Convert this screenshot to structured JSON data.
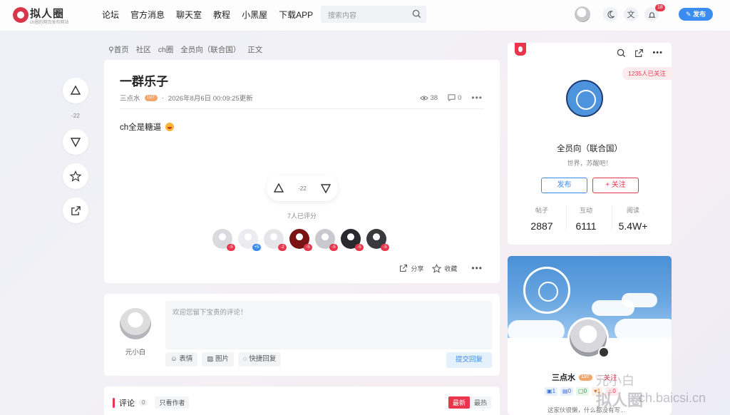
{
  "header": {
    "logo_text": "拟人圈",
    "logo_sub": "ch圈的网页发布网站",
    "nav": [
      "论坛",
      "官方消息",
      "聊天室",
      "教程",
      "小黑屋",
      "下载APP"
    ],
    "search_placeholder": "搜索内容",
    "notif_count": "18",
    "publish_label": "发布",
    "translate_glyph": "文"
  },
  "breadcrumb": [
    "首页",
    "社区",
    "ch圈",
    "全员向（联合国）",
    "正文"
  ],
  "side": {
    "score": "-22"
  },
  "post": {
    "title": "一群乐子",
    "author": "三点水",
    "level": "LV7",
    "date": "2026年8月6日 00:09:25更新",
    "views": "38",
    "comments": "0",
    "body": "ch全是糖逼",
    "vote_score": "-22",
    "rated_count": "7人已评分",
    "raters": [
      {
        "score": "-5",
        "color": "#d9d9de"
      },
      {
        "score": "+5",
        "color": "#ececf0"
      },
      {
        "score": "-2",
        "color": "#e6e6ea"
      },
      {
        "score": "-5",
        "color": "#7a1414"
      },
      {
        "score": "-5",
        "color": "#c9c9cf"
      },
      {
        "score": "-5",
        "color": "#2a2a2e"
      },
      {
        "score": "-5",
        "color": "#3a3a3e"
      }
    ],
    "share_label": "分享",
    "collect_label": "收藏"
  },
  "comment_form": {
    "user": "元小白",
    "placeholder": "欢迎您留下宝贵的评论！",
    "tools": [
      "表情",
      "图片",
      "快捷回复"
    ],
    "submit": "提交回复"
  },
  "comments_section": {
    "title": "评论",
    "count": "0",
    "author_only": "只看作者",
    "sort_new": "最新",
    "sort_hot": "最热"
  },
  "community": {
    "followers": "1235人已关注",
    "name": "全员向（联合国）",
    "desc": "世界，苏醒吧！",
    "publish": "发布",
    "follow": "+ 关注",
    "stats": [
      {
        "label": "帖子",
        "value": "2887"
      },
      {
        "label": "互动",
        "value": "6111"
      },
      {
        "label": "阅读",
        "value": "5.4W+"
      }
    ]
  },
  "author_card": {
    "name": "三点水",
    "level": "LV7",
    "follow": "♡ 关注",
    "tags": [
      "1",
      "0",
      "0",
      "1",
      "0"
    ],
    "desc": "这家伙很懒，什么都没有写..."
  },
  "watermark": {
    "line1": "元小白",
    "line2": "拟人圈",
    "domain": "ch.baicsi.cn"
  }
}
